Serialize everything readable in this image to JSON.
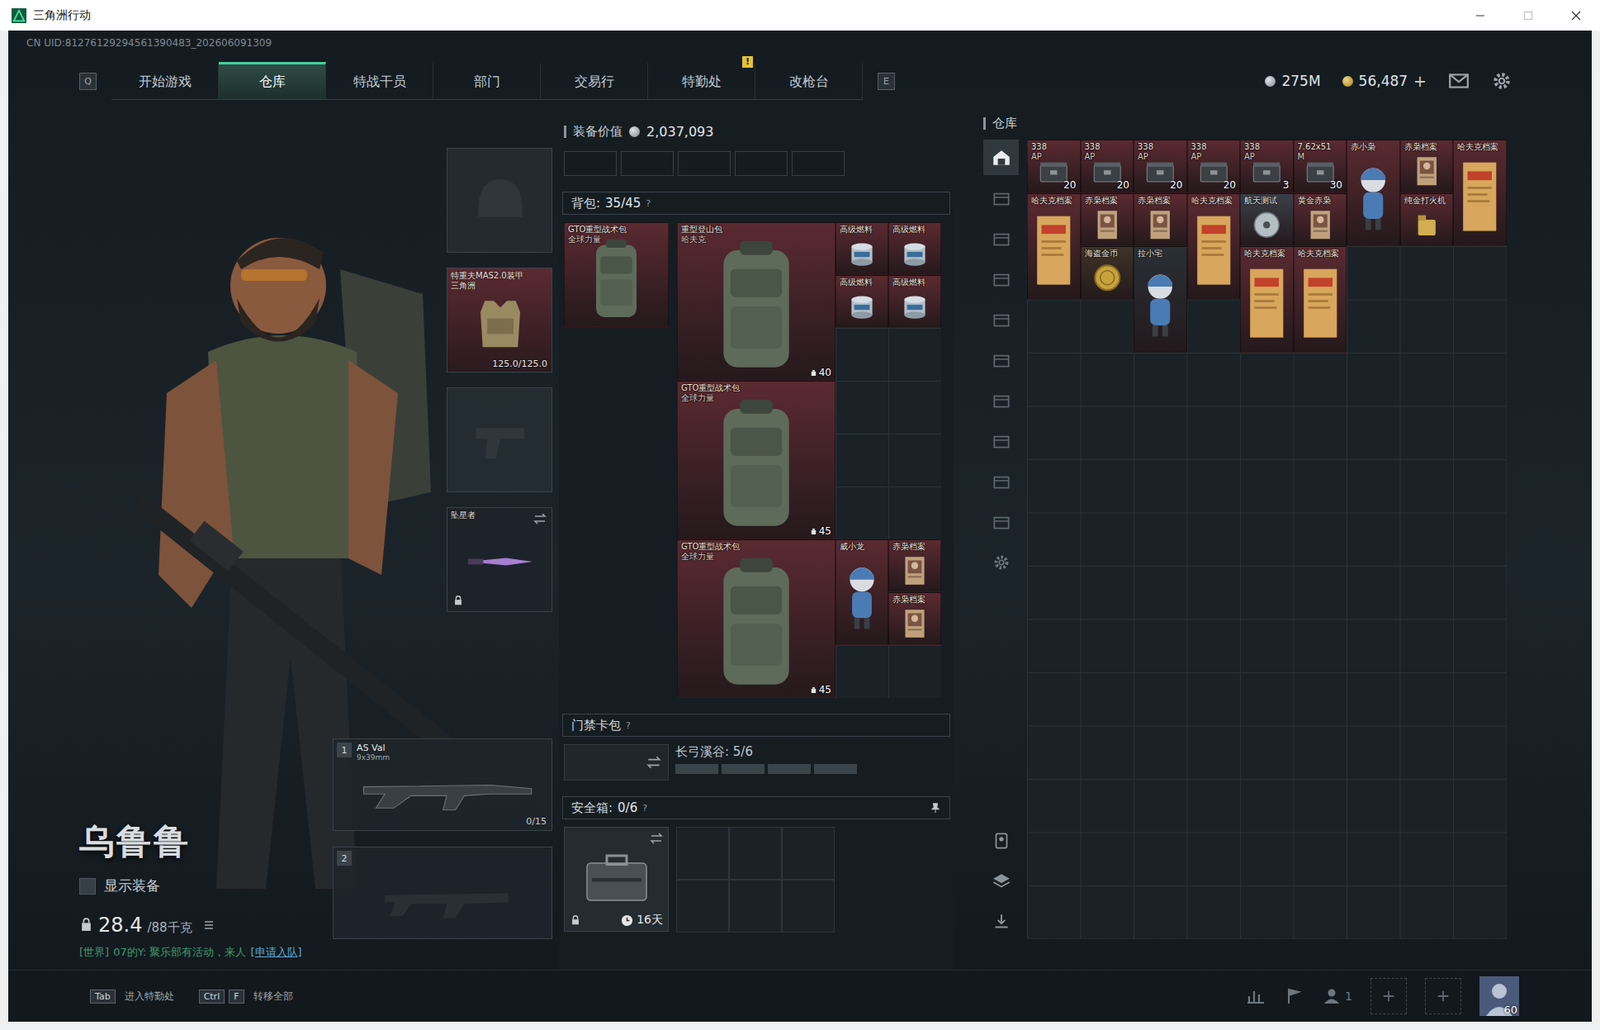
{
  "window": {
    "title": "三角洲行动",
    "uid": "CN UID:81276129294561390483_202606091309"
  },
  "nav": {
    "left_key": "Q",
    "right_key": "E",
    "tabs": [
      {
        "label": "开始游戏",
        "selected": false,
        "badge": ""
      },
      {
        "label": "仓库",
        "selected": true,
        "badge": ""
      },
      {
        "label": "特战干员",
        "selected": false,
        "badge": ""
      },
      {
        "label": "部门",
        "selected": false,
        "badge": ""
      },
      {
        "label": "交易行",
        "selected": false,
        "badge": ""
      },
      {
        "label": "特勤处",
        "selected": false,
        "badge": "!"
      },
      {
        "label": "改枪台",
        "selected": false,
        "badge": ""
      }
    ]
  },
  "currency": [
    {
      "kind": "silver",
      "amount": "275M",
      "add": ""
    },
    {
      "kind": "gold",
      "amount": "56,487",
      "add": "+"
    }
  ],
  "character": {
    "name": "乌鲁鲁",
    "show_gear": {
      "label": "显示装备",
      "checked": false
    },
    "weight": {
      "value": "28.4",
      "max": "/88千克"
    },
    "chat": {
      "channel": "[世界]",
      "text": "07的Y: 聚乐部有活动，来人",
      "action": "[申请入队]"
    }
  },
  "equipment": {
    "helmet": {
      "empty": true
    },
    "armor": {
      "name": "特重夫MAS2.0装甲",
      "sub": "三角洲",
      "durability": "125.0/125.0",
      "color": "#5b2a31"
    },
    "pistol": {
      "empty": true
    },
    "melee": {
      "name": "坠星者",
      "locked": true
    },
    "weapons": [
      {
        "slot": "1",
        "name": "AS Val",
        "caliber": "9x39mm",
        "ammo": "0/15",
        "empty": false
      },
      {
        "slot": "2",
        "name": "",
        "caliber": "",
        "ammo": "",
        "empty": true
      }
    ]
  },
  "loadout": {
    "label": "装备价值",
    "value": "2,037,093",
    "quick_slots": [
      {
        "filled": false
      },
      {
        "filled": false
      },
      {
        "filled": false
      },
      {
        "filled": false
      },
      {
        "filled": false
      }
    ]
  },
  "backpack": {
    "label": "背包:",
    "capacity": "35/45",
    "help": "?",
    "equipped": {
      "name": "GTO重型战术包",
      "sub": "全球力量",
      "count": "",
      "kind": "bag",
      "color": "#5b2a31"
    },
    "items": [
      {
        "name": "重型登山包",
        "sub": "哈夫克",
        "count": "40",
        "kind": "bag",
        "color": "#5b2a31"
      },
      {
        "name": "高级燃料",
        "sub": "",
        "count": "",
        "kind": "fuel",
        "color": "#5b2a31"
      },
      {
        "name": "高级燃料",
        "sub": "",
        "count": "",
        "kind": "fuel",
        "color": "#5b2a31"
      },
      {
        "name": "高级燃料",
        "sub": "",
        "count": "",
        "kind": "fuel",
        "color": "#5b2a31"
      },
      {
        "name": "高级燃料",
        "sub": "",
        "count": "",
        "kind": "fuel",
        "color": "#5b2a31"
      },
      {
        "name": "GTO重型战术包",
        "sub": "全球力量",
        "count": "45",
        "kind": "bag",
        "color": "#5b2a31"
      },
      {
        "name": "GTO重型战术包",
        "sub": "全球力量",
        "count": "45",
        "kind": "bag",
        "color": "#5b2a31"
      },
      {
        "name": "威小龙",
        "sub": "",
        "count": "",
        "kind": "figure-tall",
        "color": "#5b2a31"
      },
      {
        "name": "赤枭档案",
        "sub": "",
        "count": "",
        "kind": "doc",
        "color": "#5b2a31"
      },
      {
        "name": "赤枭档案",
        "sub": "",
        "count": "",
        "kind": "doc",
        "color": "#5b2a31"
      }
    ]
  },
  "keycards": {
    "label": "门禁卡包",
    "help": "?",
    "map": "长弓溪谷: 5/6",
    "keys": [
      {
        "owned": true
      },
      {
        "owned": true
      },
      {
        "owned": true
      },
      {
        "owned": true
      }
    ]
  },
  "secure": {
    "label": "安全箱:",
    "capacity": "0/6",
    "help": "?",
    "time": "16天",
    "locked": true,
    "cells": [
      {
        "filled": false
      },
      {
        "filled": false
      },
      {
        "filled": false
      },
      {
        "filled": false
      },
      {
        "filled": false
      },
      {
        "filled": false
      }
    ]
  },
  "warehouse": {
    "title": "仓库",
    "sidebar": [
      {
        "kind": "home",
        "selected": true
      },
      {
        "kind": "tier",
        "selected": false
      },
      {
        "kind": "tier",
        "selected": false
      },
      {
        "kind": "tier",
        "selected": false
      },
      {
        "kind": "tier",
        "selected": false
      },
      {
        "kind": "tier",
        "selected": false
      },
      {
        "kind": "tier",
        "selected": false
      },
      {
        "kind": "tier",
        "selected": false
      },
      {
        "kind": "tier",
        "selected": false
      },
      {
        "kind": "tier",
        "selected": false
      },
      {
        "kind": "settings",
        "selected": false
      },
      {
        "kind": "sort",
        "selected": false
      },
      {
        "kind": "layers",
        "selected": false
      },
      {
        "kind": "transfer",
        "selected": false
      }
    ],
    "items": [
      {
        "name": "338",
        "sub": "AP",
        "count": "20",
        "kind": "ammo",
        "color": "#5b2a31"
      },
      {
        "name": "338",
        "sub": "AP",
        "count": "20",
        "kind": "ammo",
        "color": "#5b2a31"
      },
      {
        "name": "338",
        "sub": "AP",
        "count": "20",
        "kind": "ammo",
        "color": "#5b2a31"
      },
      {
        "name": "338",
        "sub": "AP",
        "count": "20",
        "kind": "ammo",
        "color": "#5b2a31"
      },
      {
        "name": "338",
        "sub": "AP",
        "count": "3",
        "kind": "ammo",
        "color": "#5b2a31"
      },
      {
        "name": "7.62x51",
        "sub": "M",
        "count": "30",
        "kind": "ammo",
        "color": "#5b2a31"
      },
      {
        "name": "赤小枭",
        "sub": "",
        "count": "",
        "kind": "figure-tall",
        "color": "#5b2a31"
      },
      {
        "name": "赤枭档案",
        "sub": "",
        "count": "",
        "kind": "doc",
        "color": "#5b2a31"
      },
      {
        "name": "哈夫克档案",
        "sub": "",
        "count": "",
        "kind": "doc-tall",
        "color": "#5b2a31"
      },
      {
        "name": "哈夫克档案",
        "sub": "",
        "count": "",
        "kind": "doc-tall",
        "color": "#5b2a31"
      },
      {
        "name": "赤枭档案",
        "sub": "",
        "count": "",
        "kind": "doc",
        "color": "#5b2a31"
      },
      {
        "name": "赤枭档案",
        "sub": "",
        "count": "",
        "kind": "doc",
        "color": "#5b2a31"
      },
      {
        "name": "哈夫克档案",
        "sub": "",
        "count": "",
        "kind": "doc-tall",
        "color": "#5b2a31"
      },
      {
        "name": "航天测试",
        "sub": "",
        "count": "",
        "kind": "disc",
        "color": "#3b4048"
      },
      {
        "name": "黄金赤枭",
        "sub": "",
        "count": "",
        "kind": "doc",
        "color": "#5b2a31"
      },
      {
        "name": "纯金打火机",
        "sub": "",
        "count": "",
        "kind": "lighter",
        "color": "#5b2a31"
      },
      {
        "name": "海盗金币",
        "sub": "",
        "count": "",
        "kind": "coin",
        "color": "#3e3428"
      },
      {
        "name": "拉小宅",
        "sub": "",
        "count": "",
        "kind": "figure-tall",
        "color": "#2a3036"
      },
      {
        "name": "哈夫克档案",
        "sub": "",
        "count": "",
        "kind": "doc-tall",
        "color": "#5b2a31"
      },
      {
        "name": "哈夫克档案",
        "sub": "",
        "count": "",
        "kind": "doc-tall",
        "color": "#5b2a31"
      }
    ]
  },
  "footer": {
    "hints": [
      {
        "keys": [
          "Tab"
        ],
        "label": "进入特勤处"
      },
      {
        "keys": [
          "Ctrl",
          "F"
        ],
        "label": "转移全部"
      }
    ],
    "squad": "1",
    "level": "60"
  }
}
